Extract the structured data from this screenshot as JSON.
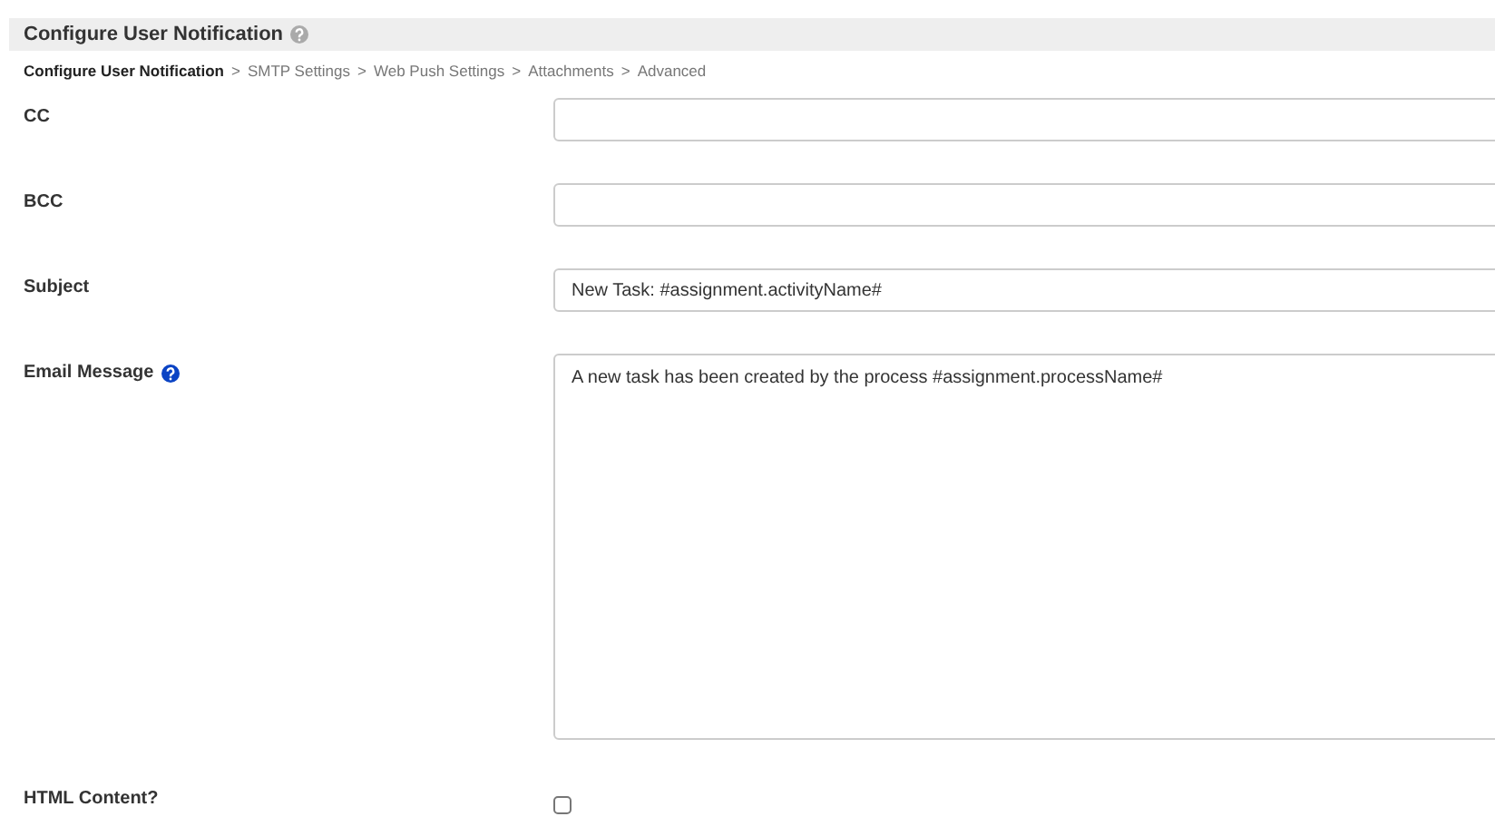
{
  "header": {
    "title": "Configure User Notification",
    "help": true
  },
  "breadcrumb": [
    {
      "label": "Configure User Notification",
      "selected": true
    },
    {
      "separator": ">",
      "label": "SMTP Settings",
      "selected": false
    },
    {
      "separator": ">",
      "label": "Web Push Settings",
      "selected": false
    },
    {
      "separator": ">",
      "label": "Attachments",
      "selected": false
    },
    {
      "separator": ">",
      "label": "Advanced",
      "selected": false
    }
  ],
  "fields": [
    {
      "kind": "text",
      "label": "CC",
      "help": false
    },
    {
      "kind": "text",
      "label": "BCC",
      "help": false
    },
    {
      "kind": "text",
      "label": "Subject",
      "help": false,
      "value": "New Task: #assignment.activityName#"
    },
    {
      "kind": "textarea",
      "label": "Email Message",
      "help": true,
      "value": "A new task has been created by the process #assignment.processName#"
    },
    {
      "kind": "checkbox",
      "label": "HTML Content?",
      "help": false,
      "checked": false
    }
  ]
}
